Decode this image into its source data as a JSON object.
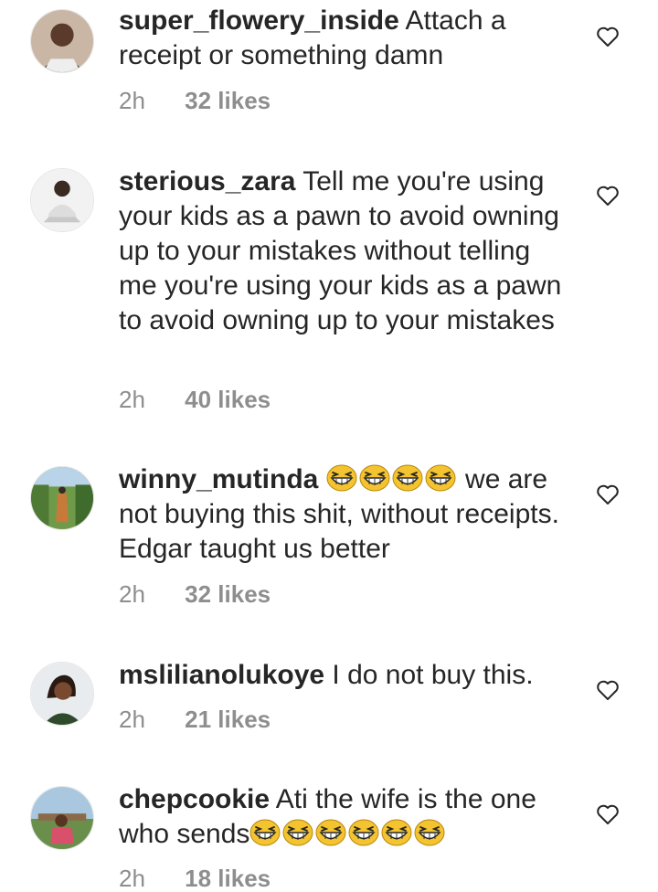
{
  "comments": [
    {
      "username": "super_flowery_inside",
      "text_parts": [
        "Attach a receipt or something damn"
      ],
      "time": "2h",
      "likes": "32 likes"
    },
    {
      "username": "sterious_zara",
      "text_parts": [
        "Tell me you're using your kids as a pawn to avoid owning up to your mistakes without telling me you're using your kids as a pawn to avoid owning up to your mistakes"
      ],
      "time": "2h",
      "likes": "40 likes"
    },
    {
      "username": "winny_mutinda",
      "text_parts": [
        "we are not buying this shit, without receipts. Edgar taught us better"
      ],
      "emoji_count_before": 4,
      "time": "2h",
      "likes": "32 likes"
    },
    {
      "username": "mslilianolukoye",
      "text_parts": [
        "I do not buy this."
      ],
      "time": "2h",
      "likes": "21 likes"
    },
    {
      "username": "chepcookie",
      "text_parts": [
        "Ati the wife is the one who sends"
      ],
      "emoji_count_after": 6,
      "time": "2h",
      "likes": "18 likes"
    }
  ],
  "icons": {
    "like": "heart-outline-icon",
    "emoji": "grinning-squinting-face-emoji"
  },
  "colors": {
    "text": "#262626",
    "meta": "#8e8e8e",
    "emoji": "#f4c430",
    "heart": "#262626"
  }
}
